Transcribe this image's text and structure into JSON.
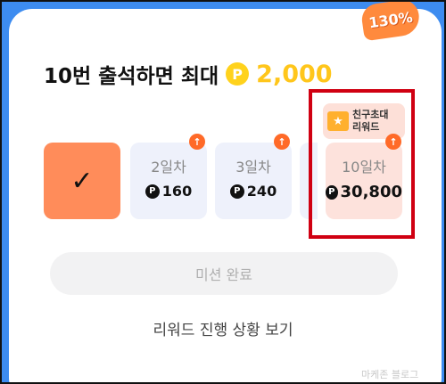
{
  "promo_badge": "130%",
  "headline": {
    "text": "10번 출석하면 최대",
    "currency_symbol": "P",
    "amount": "2,000"
  },
  "days": [
    {
      "label": "",
      "reward": "",
      "status": "done",
      "mark": "✓"
    },
    {
      "label": "2일차",
      "reward": "160"
    },
    {
      "label": "3일차",
      "reward": "240"
    },
    {
      "label": "10일차",
      "reward": "30,800"
    }
  ],
  "boost_icon": "↑",
  "invite_tag": {
    "line1": "친구초대",
    "line2": "리워드",
    "icon": "gift-icon"
  },
  "mission_button": "미션 완료",
  "progress_link": "리워드 진행 상황 보기",
  "watermark": "마케존 블로그",
  "colors": {
    "background": "#3d8cf0",
    "accent_orange": "#ff8c5a",
    "coin_yellow": "#ffd21c",
    "highlight_red": "#d00012"
  }
}
